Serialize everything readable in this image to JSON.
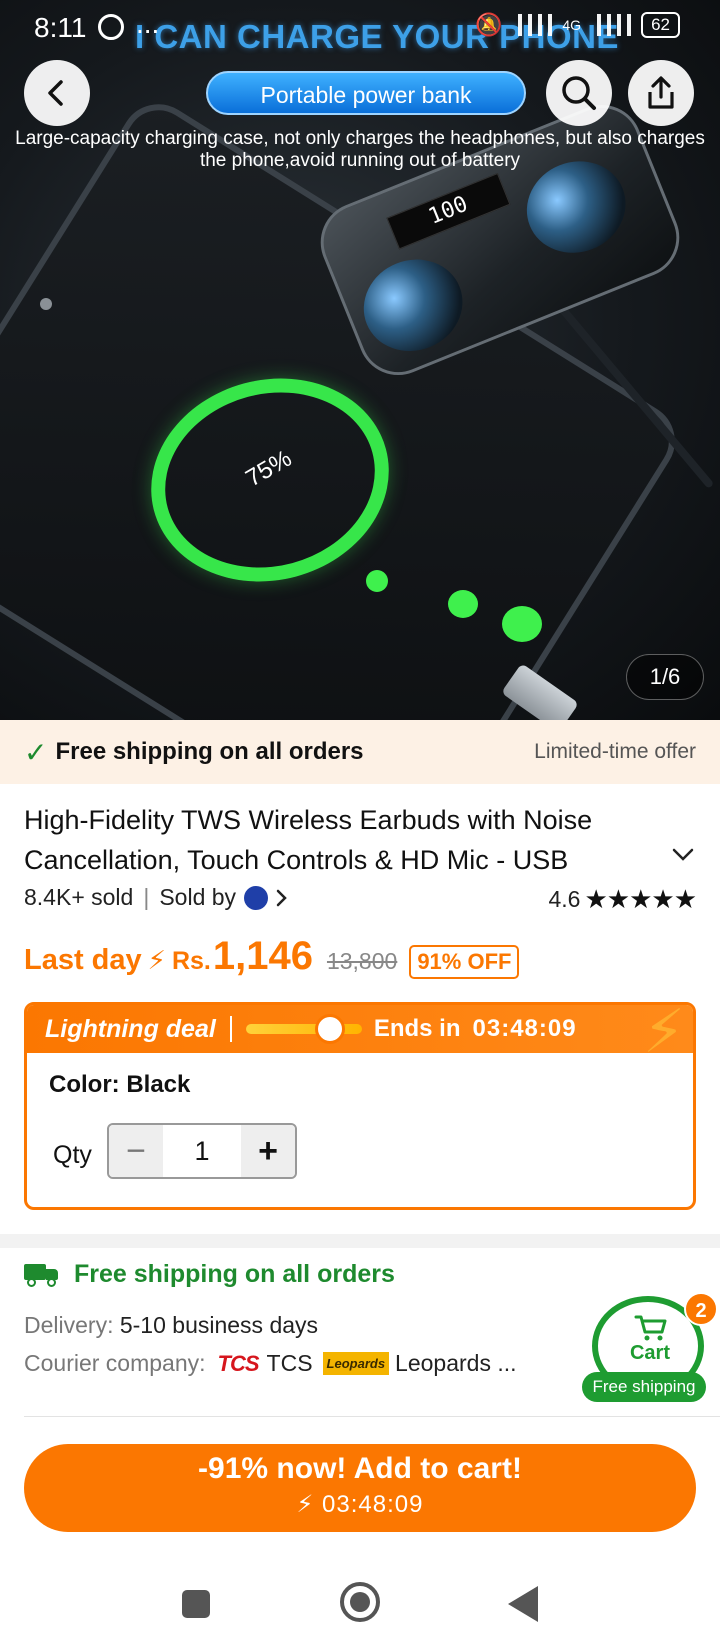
{
  "status_bar": {
    "time": "8:11",
    "dots": "...",
    "network": "4G",
    "battery": "62"
  },
  "hero": {
    "headline": "I CAN CHARGE YOUR PHONE",
    "pill": "Portable power bank",
    "caption": "Large-capacity charging case, not only charges the headphones, but also charges the phone,avoid running out of battery",
    "charge_percent": "75%",
    "case_display": "100",
    "counter": "1/6"
  },
  "banner": {
    "free_shipping": "Free shipping on all orders",
    "offer": "Limited-time offer"
  },
  "product": {
    "title": "High-Fidelity TWS Wireless Earbuds with Noise Cancellation, Touch Controls & HD Mic - USB",
    "sold": "8.4K+ sold",
    "sold_by": "Sold by",
    "rating": "4.6",
    "stars": "★★★★★"
  },
  "price": {
    "last_day": "Last day",
    "currency": "Rs.",
    "current": "1,146",
    "original": "13,800",
    "discount": "91% OFF"
  },
  "deal": {
    "label": "Lightning deal",
    "progress": 0.72,
    "ends_label": "Ends in",
    "timer": "03:48:09",
    "color_label": "Color: Black",
    "qty_label": "Qty",
    "qty_value": "1"
  },
  "shipping": {
    "title": "Free shipping on all orders",
    "delivery_key": "Delivery:",
    "delivery_value": "5-10 business days",
    "courier_key": "Courier company:",
    "courier_tcs_logo": "TCS",
    "courier_tcs": "TCS",
    "courier_leopards_logo": "Leopards",
    "courier_leopards": "Leopards ..."
  },
  "cart": {
    "label": "Cart",
    "badge": "2",
    "free": "Free shipping"
  },
  "cta": {
    "main": "-91% now! Add to cart!",
    "timer": "03:48:09"
  },
  "colors": {
    "accent": "#fb7701",
    "green": "#1e8a2e"
  }
}
